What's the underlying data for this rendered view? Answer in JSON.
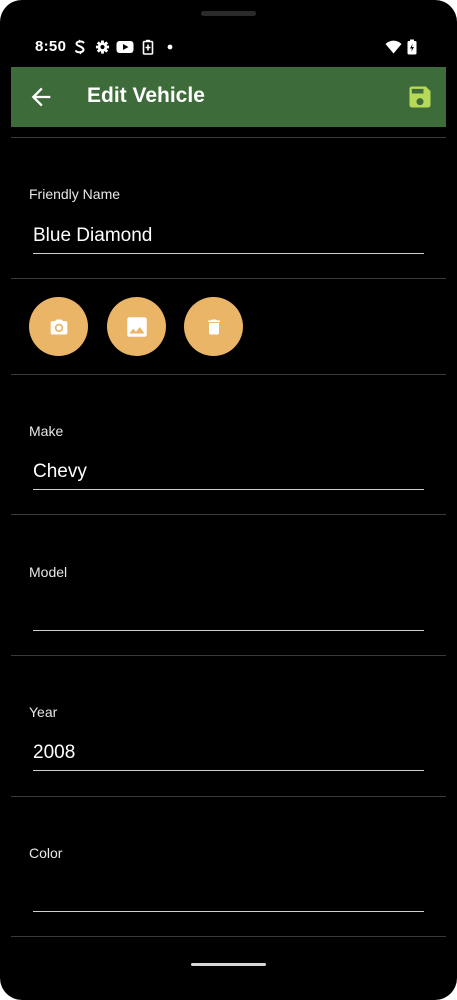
{
  "status_bar": {
    "time": "8:50",
    "icons": [
      "s-notification-icon",
      "settings-icon",
      "youtube-icon",
      "battery-saver-icon",
      "dot-icon",
      "wifi-icon",
      "battery-icon"
    ]
  },
  "app_bar": {
    "title": "Edit Vehicle",
    "back_icon": "arrow-back-icon",
    "save_icon": "save-icon"
  },
  "colors": {
    "app_bar_bg": "#3e6b3a",
    "accent_button": "#eab567",
    "save_icon": "#b6d957",
    "background": "#000000"
  },
  "form": {
    "friendly_name": {
      "label": "Friendly Name",
      "value": "Blue Diamond"
    },
    "photo_buttons": [
      {
        "name": "camera",
        "icon": "camera-icon"
      },
      {
        "name": "gallery",
        "icon": "image-icon"
      },
      {
        "name": "delete",
        "icon": "trash-icon"
      }
    ],
    "make": {
      "label": "Make",
      "value": "Chevy"
    },
    "model": {
      "label": "Model",
      "value": ""
    },
    "year": {
      "label": "Year",
      "value": "2008"
    },
    "color": {
      "label": "Color",
      "value": ""
    }
  }
}
